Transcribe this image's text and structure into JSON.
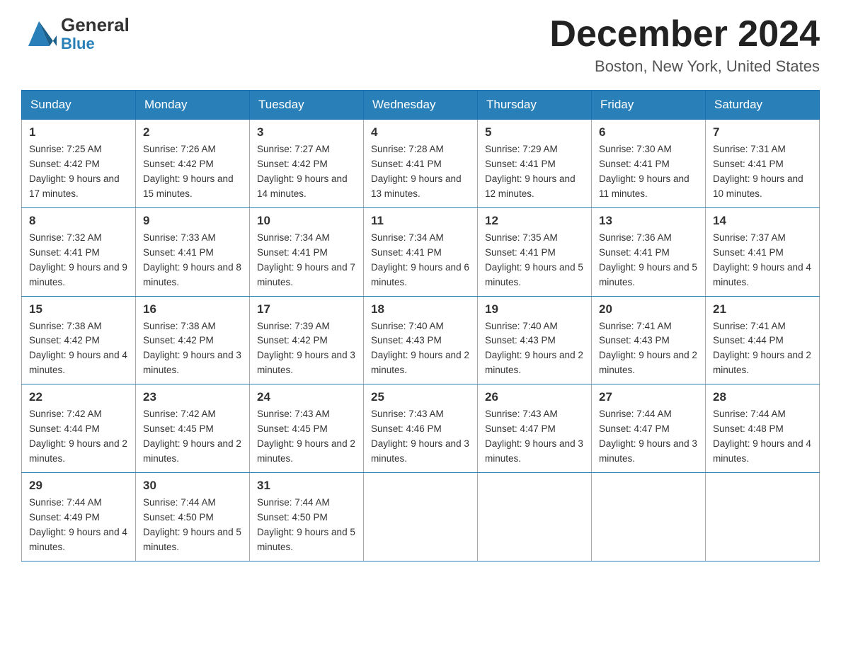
{
  "header": {
    "logo_general": "General",
    "logo_blue": "Blue",
    "month_title": "December 2024",
    "location": "Boston, New York, United States"
  },
  "days_of_week": [
    "Sunday",
    "Monday",
    "Tuesday",
    "Wednesday",
    "Thursday",
    "Friday",
    "Saturday"
  ],
  "weeks": [
    [
      {
        "day": "1",
        "sunrise": "Sunrise: 7:25 AM",
        "sunset": "Sunset: 4:42 PM",
        "daylight": "Daylight: 9 hours and 17 minutes."
      },
      {
        "day": "2",
        "sunrise": "Sunrise: 7:26 AM",
        "sunset": "Sunset: 4:42 PM",
        "daylight": "Daylight: 9 hours and 15 minutes."
      },
      {
        "day": "3",
        "sunrise": "Sunrise: 7:27 AM",
        "sunset": "Sunset: 4:42 PM",
        "daylight": "Daylight: 9 hours and 14 minutes."
      },
      {
        "day": "4",
        "sunrise": "Sunrise: 7:28 AM",
        "sunset": "Sunset: 4:41 PM",
        "daylight": "Daylight: 9 hours and 13 minutes."
      },
      {
        "day": "5",
        "sunrise": "Sunrise: 7:29 AM",
        "sunset": "Sunset: 4:41 PM",
        "daylight": "Daylight: 9 hours and 12 minutes."
      },
      {
        "day": "6",
        "sunrise": "Sunrise: 7:30 AM",
        "sunset": "Sunset: 4:41 PM",
        "daylight": "Daylight: 9 hours and 11 minutes."
      },
      {
        "day": "7",
        "sunrise": "Sunrise: 7:31 AM",
        "sunset": "Sunset: 4:41 PM",
        "daylight": "Daylight: 9 hours and 10 minutes."
      }
    ],
    [
      {
        "day": "8",
        "sunrise": "Sunrise: 7:32 AM",
        "sunset": "Sunset: 4:41 PM",
        "daylight": "Daylight: 9 hours and 9 minutes."
      },
      {
        "day": "9",
        "sunrise": "Sunrise: 7:33 AM",
        "sunset": "Sunset: 4:41 PM",
        "daylight": "Daylight: 9 hours and 8 minutes."
      },
      {
        "day": "10",
        "sunrise": "Sunrise: 7:34 AM",
        "sunset": "Sunset: 4:41 PM",
        "daylight": "Daylight: 9 hours and 7 minutes."
      },
      {
        "day": "11",
        "sunrise": "Sunrise: 7:34 AM",
        "sunset": "Sunset: 4:41 PM",
        "daylight": "Daylight: 9 hours and 6 minutes."
      },
      {
        "day": "12",
        "sunrise": "Sunrise: 7:35 AM",
        "sunset": "Sunset: 4:41 PM",
        "daylight": "Daylight: 9 hours and 5 minutes."
      },
      {
        "day": "13",
        "sunrise": "Sunrise: 7:36 AM",
        "sunset": "Sunset: 4:41 PM",
        "daylight": "Daylight: 9 hours and 5 minutes."
      },
      {
        "day": "14",
        "sunrise": "Sunrise: 7:37 AM",
        "sunset": "Sunset: 4:41 PM",
        "daylight": "Daylight: 9 hours and 4 minutes."
      }
    ],
    [
      {
        "day": "15",
        "sunrise": "Sunrise: 7:38 AM",
        "sunset": "Sunset: 4:42 PM",
        "daylight": "Daylight: 9 hours and 4 minutes."
      },
      {
        "day": "16",
        "sunrise": "Sunrise: 7:38 AM",
        "sunset": "Sunset: 4:42 PM",
        "daylight": "Daylight: 9 hours and 3 minutes."
      },
      {
        "day": "17",
        "sunrise": "Sunrise: 7:39 AM",
        "sunset": "Sunset: 4:42 PM",
        "daylight": "Daylight: 9 hours and 3 minutes."
      },
      {
        "day": "18",
        "sunrise": "Sunrise: 7:40 AM",
        "sunset": "Sunset: 4:43 PM",
        "daylight": "Daylight: 9 hours and 2 minutes."
      },
      {
        "day": "19",
        "sunrise": "Sunrise: 7:40 AM",
        "sunset": "Sunset: 4:43 PM",
        "daylight": "Daylight: 9 hours and 2 minutes."
      },
      {
        "day": "20",
        "sunrise": "Sunrise: 7:41 AM",
        "sunset": "Sunset: 4:43 PM",
        "daylight": "Daylight: 9 hours and 2 minutes."
      },
      {
        "day": "21",
        "sunrise": "Sunrise: 7:41 AM",
        "sunset": "Sunset: 4:44 PM",
        "daylight": "Daylight: 9 hours and 2 minutes."
      }
    ],
    [
      {
        "day": "22",
        "sunrise": "Sunrise: 7:42 AM",
        "sunset": "Sunset: 4:44 PM",
        "daylight": "Daylight: 9 hours and 2 minutes."
      },
      {
        "day": "23",
        "sunrise": "Sunrise: 7:42 AM",
        "sunset": "Sunset: 4:45 PM",
        "daylight": "Daylight: 9 hours and 2 minutes."
      },
      {
        "day": "24",
        "sunrise": "Sunrise: 7:43 AM",
        "sunset": "Sunset: 4:45 PM",
        "daylight": "Daylight: 9 hours and 2 minutes."
      },
      {
        "day": "25",
        "sunrise": "Sunrise: 7:43 AM",
        "sunset": "Sunset: 4:46 PM",
        "daylight": "Daylight: 9 hours and 3 minutes."
      },
      {
        "day": "26",
        "sunrise": "Sunrise: 7:43 AM",
        "sunset": "Sunset: 4:47 PM",
        "daylight": "Daylight: 9 hours and 3 minutes."
      },
      {
        "day": "27",
        "sunrise": "Sunrise: 7:44 AM",
        "sunset": "Sunset: 4:47 PM",
        "daylight": "Daylight: 9 hours and 3 minutes."
      },
      {
        "day": "28",
        "sunrise": "Sunrise: 7:44 AM",
        "sunset": "Sunset: 4:48 PM",
        "daylight": "Daylight: 9 hours and 4 minutes."
      }
    ],
    [
      {
        "day": "29",
        "sunrise": "Sunrise: 7:44 AM",
        "sunset": "Sunset: 4:49 PM",
        "daylight": "Daylight: 9 hours and 4 minutes."
      },
      {
        "day": "30",
        "sunrise": "Sunrise: 7:44 AM",
        "sunset": "Sunset: 4:50 PM",
        "daylight": "Daylight: 9 hours and 5 minutes."
      },
      {
        "day": "31",
        "sunrise": "Sunrise: 7:44 AM",
        "sunset": "Sunset: 4:50 PM",
        "daylight": "Daylight: 9 hours and 5 minutes."
      },
      null,
      null,
      null,
      null
    ]
  ]
}
